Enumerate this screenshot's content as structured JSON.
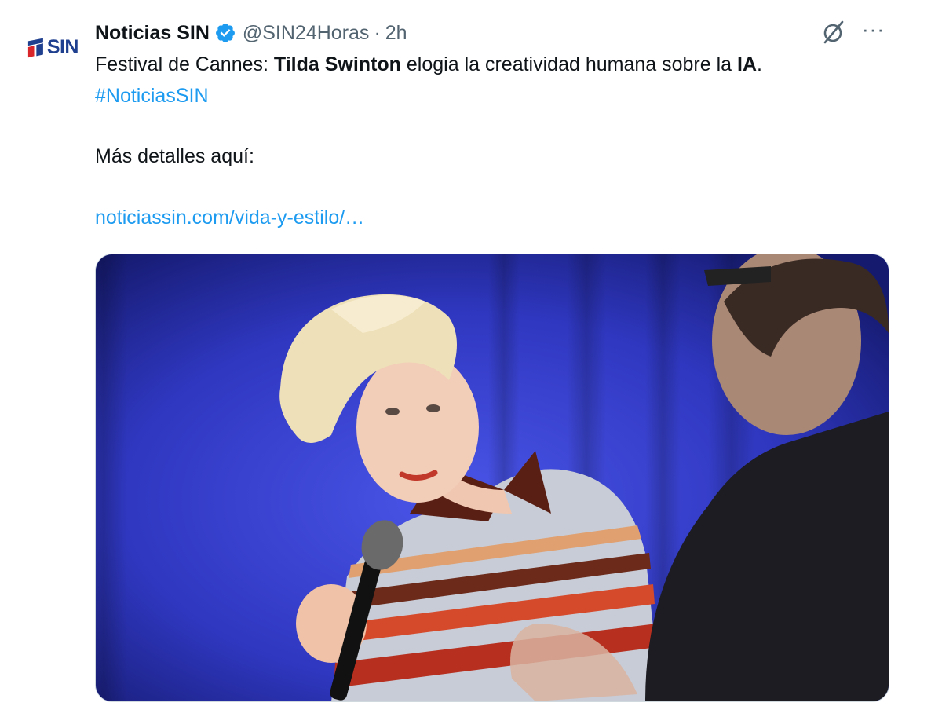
{
  "tweet": {
    "author_name": "Noticias SIN",
    "handle": "@SIN24Horas",
    "separator": "·",
    "time": "2h",
    "logo_text": "SIN",
    "text_line1_prefix": "Festival de Cannes: ",
    "text_line1_bold": "Tilda Swinton",
    "text_line1_middle": " elogia la creatividad humana sobre la ",
    "text_line1_bold2": "IA",
    "text_line1_end": ".",
    "hashtag": "#NoticiasSIN",
    "details_text": "Más detalles aquí:",
    "link_text": "noticiassin.com/vida-y-estilo/…",
    "more_label": "···"
  },
  "icons": {
    "verified": "verified-badge-icon",
    "grok": "grok-icon",
    "more": "more-icon"
  },
  "colors": {
    "link": "#1d9bf0",
    "secondary": "#536471",
    "verified": "#1d9bf0",
    "logo": "#1f3f8f",
    "logo_accent": "#d8262b"
  }
}
